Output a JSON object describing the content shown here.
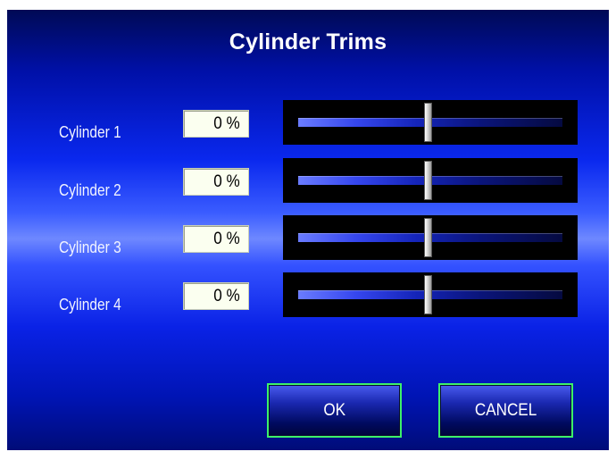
{
  "dialog": {
    "title": "Cylinder Trims",
    "ok_label": "OK",
    "cancel_label": "CANCEL"
  },
  "cylinders": [
    {
      "label": "Cylinder 1",
      "value_text": "0 %",
      "trim_percent": 0
    },
    {
      "label": "Cylinder 2",
      "value_text": "0 %",
      "trim_percent": 0
    },
    {
      "label": "Cylinder 3",
      "value_text": "0 %",
      "trim_percent": 0
    },
    {
      "label": "Cylinder 4",
      "value_text": "0 %",
      "trim_percent": 0
    }
  ],
  "colors": {
    "panel_blue": "#0a28ee",
    "button_border": "#3df06a",
    "value_box": "#fbfff0"
  }
}
